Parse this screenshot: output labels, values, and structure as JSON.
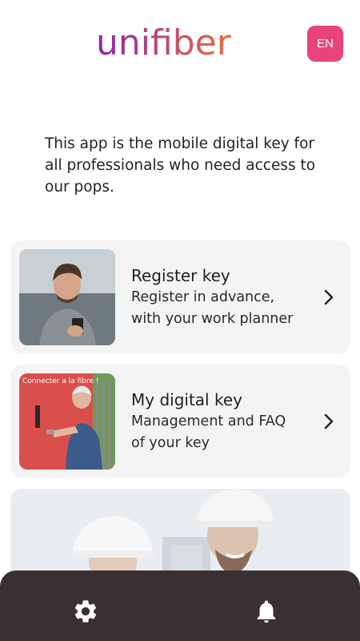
{
  "header": {
    "logo_text": "unifiber",
    "language_button": "EN"
  },
  "intro": {
    "text": "This app is the mobile digital key for all professionals who need access to our pops."
  },
  "cards": [
    {
      "title": "Register key",
      "subtitle": "Register in advance,\nwith your work planner",
      "image": "man-with-phone-photo"
    },
    {
      "title": "My digital key",
      "subtitle": "Management and FAQ\nof your key",
      "image": "technician-opening-cabinet-photo",
      "image_text": "Connecter a la fibre !"
    }
  ],
  "banner": {
    "image": "workers-with-helmets-photo"
  },
  "bottom_nav": {
    "items": [
      {
        "icon": "gear-icon"
      },
      {
        "icon": "bell-icon"
      }
    ]
  },
  "colors": {
    "accent": "#e8447a",
    "logo_gradient_start": "#8a2aa8",
    "logo_gradient_end": "#f06a3a",
    "nav_background": "#3a2f31",
    "card_background": "#f5f4f4"
  }
}
